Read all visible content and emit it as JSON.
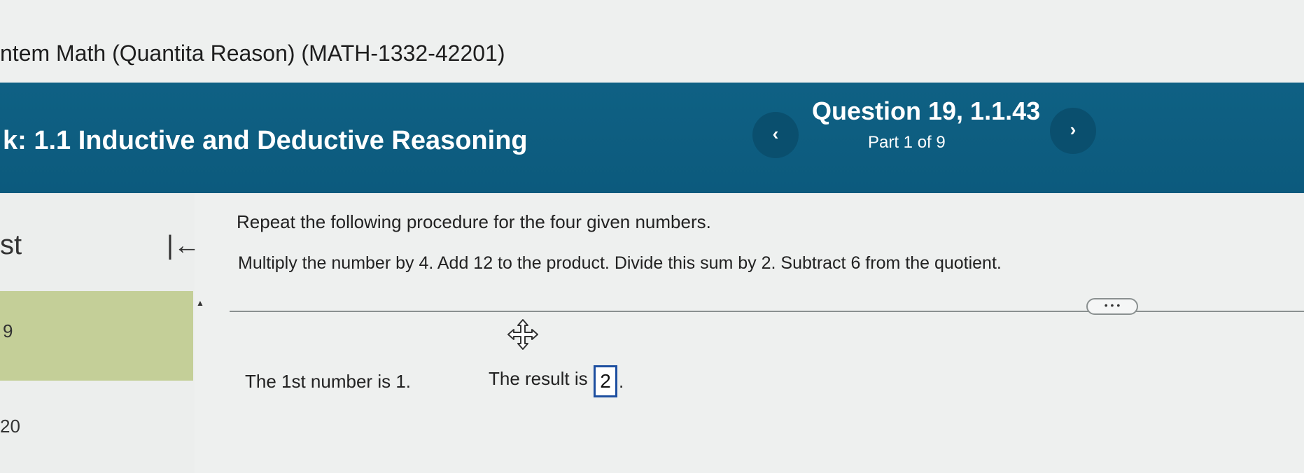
{
  "course": {
    "title": "ntem Math (Quantita Reason) (MATH-1332-42201)"
  },
  "header": {
    "section_title": "k: 1.1 Inductive and Deductive Reasoning",
    "question_label": "Question 19, 1.1.43",
    "part_label": "Part 1 of 9",
    "prev_glyph": "‹",
    "next_glyph": "›",
    "band_color": "#0f6184"
  },
  "sidebar": {
    "heading": "st",
    "items": [
      {
        "label": "9",
        "highlight_color": "#c4cf98"
      },
      {
        "label": "20"
      }
    ],
    "collapse_glyph": "|←"
  },
  "question": {
    "prompt": "Repeat the following procedure for the four given numbers.",
    "procedure": "Multiply the number by 4. Add 12 to the product. Divide this sum by 2. Subtract 6 from the quotient.",
    "more_label": "• • •",
    "first_number_text": "The 1st number is 1.",
    "result_label": "The result is",
    "answer_value": "2",
    "answer_suffix": "."
  }
}
